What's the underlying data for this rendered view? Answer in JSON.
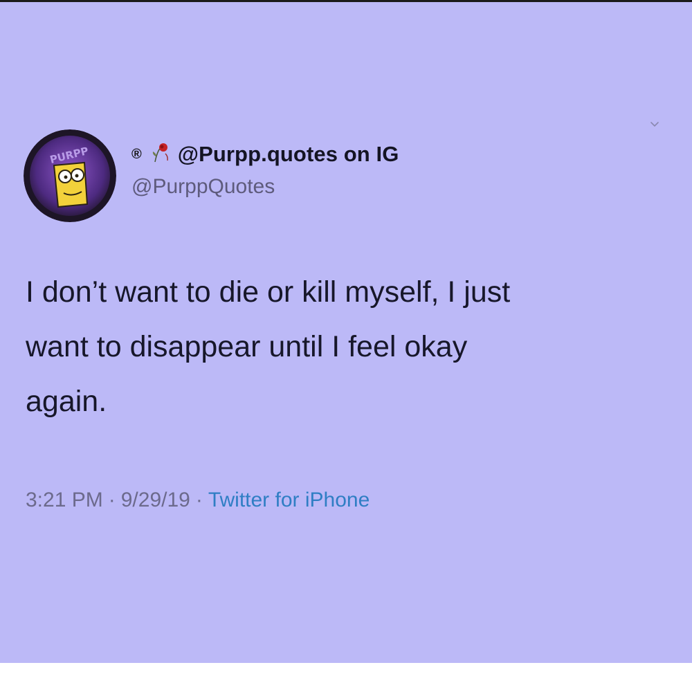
{
  "tweet": {
    "display_name": "@Purpp.quotes on IG",
    "handle": "@PurppQuotes",
    "text": "I don’t want to die or kill myself, I just\nwant to disappear until I feel okay\nagain.",
    "time": "3:21 PM",
    "date": "9/29/19",
    "source": "Twitter for iPhone",
    "separator": "·",
    "registered_symbol": "®",
    "avatar_text": "PURPP",
    "icons": [
      "chevron-down-icon",
      "registered-icon",
      "wilted-rose-icon"
    ]
  },
  "colors": {
    "card_background": "#bcb9f7",
    "text": "#17172a",
    "handle": "#5e5b7c",
    "link": "#2f7ec4",
    "avatar_ring": "#2a1f3a",
    "avatar_inner": "#6b3ca6"
  }
}
